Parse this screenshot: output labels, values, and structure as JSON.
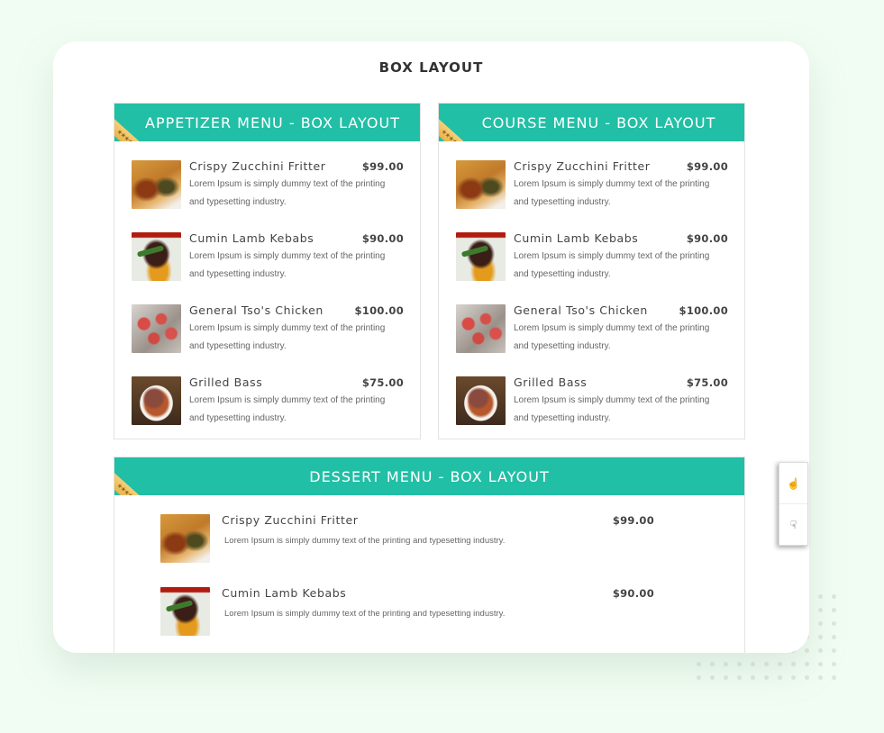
{
  "page": {
    "title": "BOX LAYOUT"
  },
  "menus": [
    {
      "id": "appetizer",
      "title": "APPETIZER MENU - BOX LAYOUT",
      "ribbon": "★★★★★",
      "items": [
        {
          "name": "Crispy Zucchini Fritter",
          "price": "$99.00",
          "desc": "Lorem Ipsum is simply dummy text of the printing and typesetting industry.",
          "image": "zucchini-fritter"
        },
        {
          "name": "Cumin Lamb Kebabs",
          "price": "$90.00",
          "desc": "Lorem Ipsum is simply dummy text of the printing and typesetting industry.",
          "image": "lamb-kebabs"
        },
        {
          "name": "General Tso's Chicken",
          "price": "$100.00",
          "desc": "Lorem Ipsum is simply dummy text of the printing and typesetting industry.",
          "image": "tsos-chicken"
        },
        {
          "name": "Grilled Bass",
          "price": "$75.00",
          "desc": "Lorem Ipsum is simply dummy text of the printing and typesetting industry.",
          "image": "grilled-bass"
        }
      ]
    },
    {
      "id": "course",
      "title": "COURSE MENU - BOX LAYOUT",
      "ribbon": "★★★★★",
      "items": [
        {
          "name": "Crispy Zucchini Fritter",
          "price": "$99.00",
          "desc": "Lorem Ipsum is simply dummy text of the printing and typesetting industry.",
          "image": "zucchini-fritter"
        },
        {
          "name": "Cumin Lamb Kebabs",
          "price": "$90.00",
          "desc": "Lorem Ipsum is simply dummy text of the printing and typesetting industry.",
          "image": "lamb-kebabs"
        },
        {
          "name": "General Tso's Chicken",
          "price": "$100.00",
          "desc": "Lorem Ipsum is simply dummy text of the printing and typesetting industry.",
          "image": "tsos-chicken"
        },
        {
          "name": "Grilled Bass",
          "price": "$75.00",
          "desc": "Lorem Ipsum is simply dummy text of the printing and typesetting industry.",
          "image": "grilled-bass"
        }
      ]
    },
    {
      "id": "dessert",
      "title": "DESSERT MENU - BOX LAYOUT",
      "ribbon": "★★★★★",
      "items": [
        {
          "name": "Crispy Zucchini Fritter",
          "price": "$99.00",
          "desc": "Lorem Ipsum is simply dummy text of the printing and typesetting industry.",
          "image": "zucchini-fritter"
        },
        {
          "name": "Cumin Lamb Kebabs",
          "price": "$90.00",
          "desc": "Lorem Ipsum is simply dummy text of the printing and typesetting industry.",
          "image": "lamb-kebabs"
        }
      ]
    }
  ],
  "side_widget": {
    "buttons": [
      {
        "icon": "pointing-hand-icon",
        "glyph": "☝"
      },
      {
        "icon": "pointing-hand-down-icon",
        "glyph": "☟"
      }
    ]
  },
  "colors": {
    "accent": "#21bfa6",
    "ribbon": "#f0c35f",
    "background": "#f1fdf3"
  }
}
